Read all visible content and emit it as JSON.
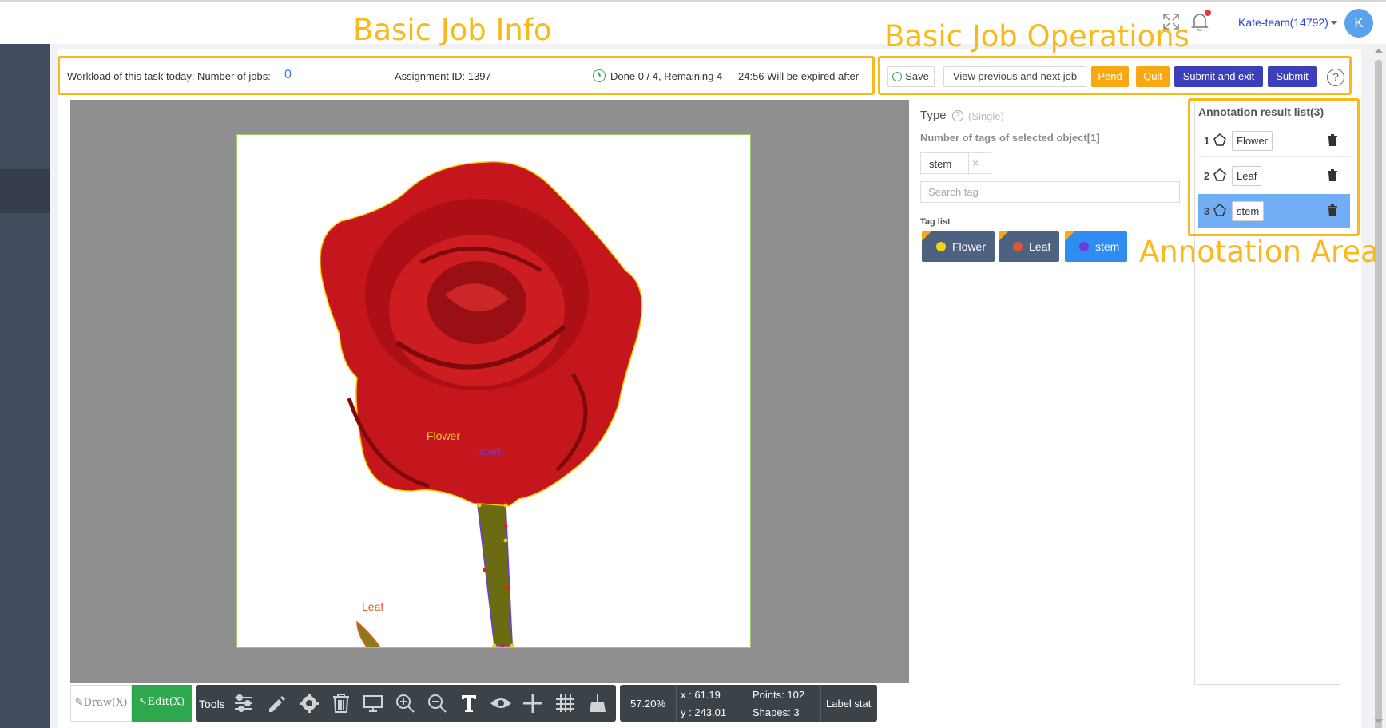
{
  "header": {
    "user_label": "Kate-team(14792)",
    "avatar_initial": "K",
    "icons": [
      "expand-icon",
      "bell-icon",
      "caret-down-icon"
    ]
  },
  "info_bar": {
    "workload_label": "Workload of this task today: Number of jobs:",
    "jobs_count": "0",
    "assignment": "Assignment ID: 1397",
    "progress": "Done 0 / 4, Remaining 4",
    "expire": "24:56 Will be expired after"
  },
  "operations": {
    "save": "Save",
    "view_prev_next": "View previous and next job",
    "pend": "Pend",
    "quit": "Quit",
    "submit_exit": "Submit and exit",
    "submit": "Submit",
    "help": "?"
  },
  "canvas": {
    "labels": {
      "flower": "Flower",
      "stem": "stem",
      "leaf": "Leaf"
    },
    "colors": {
      "flower": "#f4c430",
      "leaf": "#e55b2a",
      "stem": "#6a3cd9",
      "background": "#8f8f8f"
    }
  },
  "toolbar": {
    "draw": "Draw(X)",
    "edit": "Edit(X)",
    "tools": "Tools",
    "zoom": "57.20%",
    "x": "x : 61.19",
    "y": "y : 243.01",
    "points": "Points:  102",
    "shapes": "Shapes:  3",
    "label_stat": "Label stat",
    "icons": [
      "sliders-icon",
      "pencil-icon",
      "gear-icon",
      "trash-icon",
      "monitor-icon",
      "zoom-in-icon",
      "zoom-out-icon",
      "text-icon",
      "eye-icon",
      "crosshair-icon",
      "grid-icon",
      "broom-icon"
    ]
  },
  "type_panel": {
    "title": "Type",
    "mode": "(Single)",
    "tag_count": "Number of tags of selected object[1]",
    "selected_tag": "stem",
    "search_placeholder": "Search tag",
    "taglist_label": "Tag list",
    "tags": [
      {
        "label": "Flower",
        "color": "#f5d310"
      },
      {
        "label": "Leaf",
        "color": "#e4572e"
      },
      {
        "label": "stem",
        "color": "#6a3cd9"
      }
    ]
  },
  "result_panel": {
    "title": "Annotation result list(3)",
    "items": [
      {
        "num": "1",
        "label": "Flower"
      },
      {
        "num": "2",
        "label": "Leaf"
      },
      {
        "num": "3",
        "label": "stem"
      }
    ]
  },
  "callouts": {
    "job_info": "Basic Job Info",
    "job_ops": "Basic Job Operations",
    "annotation_area": "Annotation Area",
    "color": "#f9b91b"
  }
}
